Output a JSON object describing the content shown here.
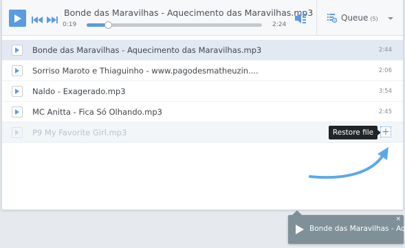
{
  "player": {
    "title": "Bonde das Maravilhas - Aquecimento das Maravilhas.mp3",
    "current_time": "0:19",
    "total_time": "2:24",
    "progress": 0.12
  },
  "queue": {
    "label": "Queue",
    "count": "(5)"
  },
  "tracks": [
    {
      "name": "Bonde das Maravilhas - Aquecimento das Maravilhas.mp3",
      "duration": "2:44"
    },
    {
      "name": "Sorriso Maroto e Thiaguinho - www.pagodesmatheuzin....",
      "duration": "2:06"
    },
    {
      "name": "Naldo - Exagerado.mp3",
      "duration": "3:54"
    },
    {
      "name": "MC Anitta - Fica Só Olhando.mp3",
      "duration": "2:45"
    },
    {
      "name": "P9 My Favorite Girl.mp3",
      "duration": ""
    }
  ],
  "tooltip": "Restore file",
  "restore_symbol": "+",
  "mini_player": {
    "title": "Bonde das Maravilhas - Aqu...",
    "close": "×"
  },
  "colors": {
    "accent": "#5b9be0",
    "mini_player_bg": "#7f9099",
    "tooltip_bg": "#222528"
  }
}
